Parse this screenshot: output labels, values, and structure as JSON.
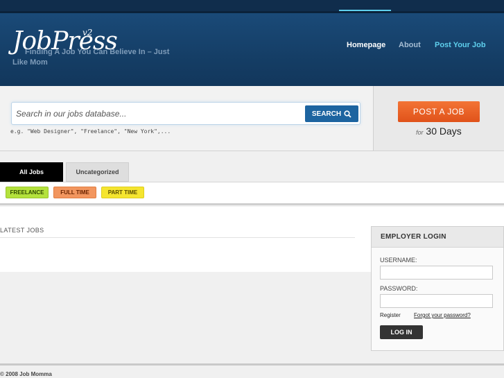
{
  "header": {
    "logo": "JobPress",
    "logo_version": "v2",
    "tagline": "Finding A Job You Can Believe In – Just Like Mom",
    "nav": [
      {
        "label": "Homepage"
      },
      {
        "label": "About"
      },
      {
        "label": "Post Your Job"
      }
    ]
  },
  "search": {
    "placeholder": "Search in our jobs database...",
    "button_label": "SEARCH",
    "hint": "e.g. \"Web Designer\", \"Freelance\", \"New York\",..."
  },
  "post": {
    "button_label": "POST A JOB",
    "for_label": "for",
    "days_label": "30 Days"
  },
  "tabs": [
    {
      "label": "All Jobs"
    },
    {
      "label": "Uncategorized"
    }
  ],
  "tags": [
    {
      "label": "FREELANCE"
    },
    {
      "label": "FULL TIME"
    },
    {
      "label": "PART TIME"
    }
  ],
  "main": {
    "latest_heading": "LATEST JOBS"
  },
  "login": {
    "title": "EMPLOYER LOGIN",
    "username_label": "USERNAME:",
    "password_label": "PASSWORD:",
    "register_label": "Register",
    "forgot_label": "Forgot your password?",
    "button_label": "LOG IN"
  },
  "footer": {
    "copyright": "© 2008 Job Momma"
  }
}
